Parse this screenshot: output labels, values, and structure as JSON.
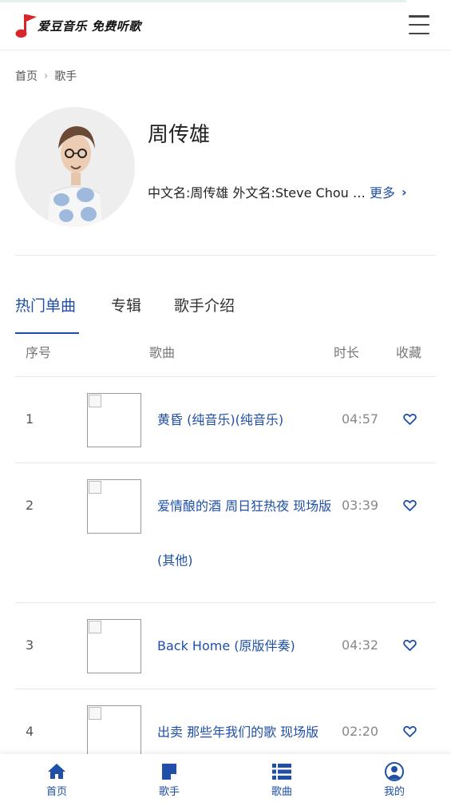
{
  "header": {
    "logo_text": "爱豆音乐 免费听歌",
    "logo_icon": "music-note-flag-icon",
    "menu_icon": "hamburger-menu-icon"
  },
  "breadcrumb": {
    "home": "首页",
    "current": "歌手"
  },
  "singer": {
    "name": "周传雄",
    "meta": "中文名:周传雄 外文名:Steve Chou 出生日期",
    "more_label": "更多"
  },
  "tabs": [
    {
      "label": "热门单曲",
      "active": true
    },
    {
      "label": "专辑",
      "active": false
    },
    {
      "label": "歌手介绍",
      "active": false
    }
  ],
  "table": {
    "headers": {
      "index": "序号",
      "song": "歌曲",
      "duration": "时长",
      "favorite": "收藏"
    },
    "rows": [
      {
        "index": "1",
        "title": "黄昏 (纯音乐)(纯音乐)",
        "duration": "04:57"
      },
      {
        "index": "2",
        "title": "爱情酿的酒 周日狂热夜 现场版(其他)",
        "duration": "03:39"
      },
      {
        "index": "3",
        "title": "Back Home (原版伴奏)",
        "duration": "04:32"
      },
      {
        "index": "4",
        "title": "出卖 那些年我们的歌 现场版",
        "duration": "02:20"
      }
    ]
  },
  "bottom_nav": [
    {
      "label": "首页",
      "icon": "home-icon"
    },
    {
      "label": "歌手",
      "icon": "singer-icon"
    },
    {
      "label": "歌曲",
      "icon": "song-list-icon"
    },
    {
      "label": "我的",
      "icon": "user-icon"
    }
  ],
  "colors": {
    "accent": "#1f4fa6",
    "logo_red": "#d8262b"
  }
}
